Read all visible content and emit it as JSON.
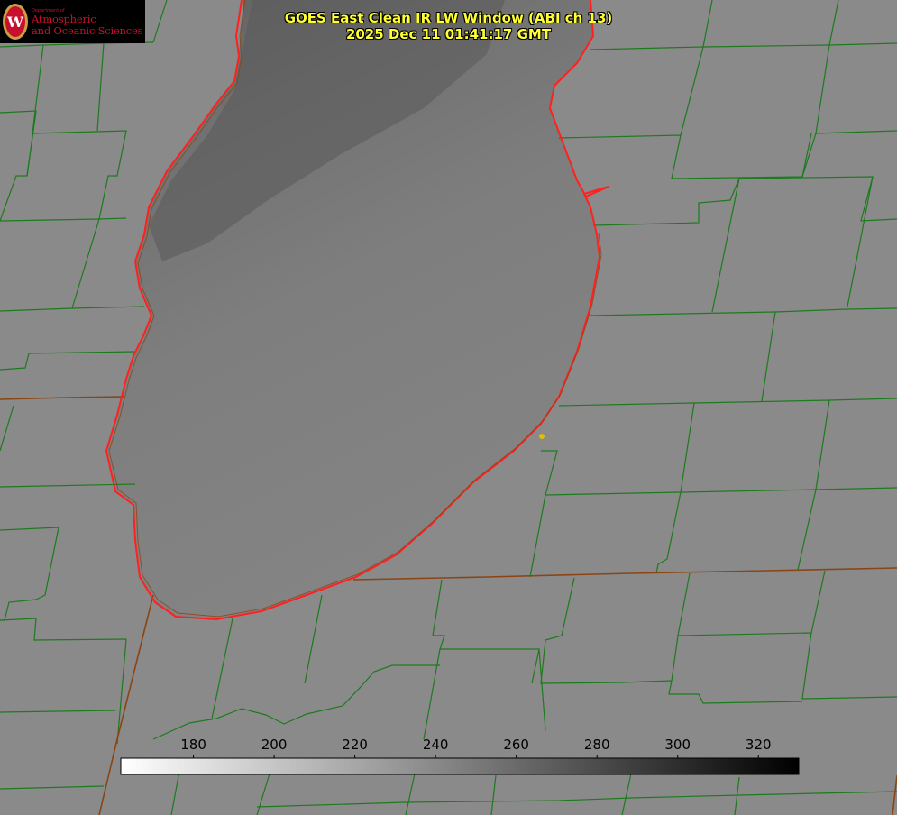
{
  "title": {
    "line1": "GOES East Clean IR LW Window (ABI ch 13)",
    "line2": "2025 Dec 11 01:41:17 GMT"
  },
  "logo": {
    "dept": "Department of",
    "line1": "Atmospheric",
    "line2": "and Oceanic Sciences",
    "seal_letter": "W"
  },
  "colorbar": {
    "ticks": [
      180,
      200,
      220,
      240,
      260,
      280,
      300,
      320
    ],
    "range": [
      162,
      330
    ],
    "color_low": "#ffffff",
    "color_high": "#000000"
  },
  "colors": {
    "county_lines": "#1e7a1e",
    "state_lines": "#8b4513",
    "lake_shore": "#ff2020",
    "title_text": "#ffff33",
    "logo_red": "#c8102e",
    "marker": "#e0c000"
  }
}
